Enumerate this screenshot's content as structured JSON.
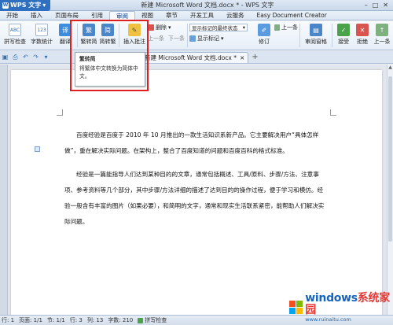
{
  "titlebar": {
    "app_label": "WPS 文字",
    "title": "新建 Microsoft Word 文档.docx * - WPS 文字"
  },
  "menu": {
    "tabs": [
      "开始",
      "插入",
      "页面布局",
      "引用",
      "审阅",
      "视图",
      "章节",
      "开发工具",
      "云服务",
      "Easy Document Creator"
    ],
    "active_index": 4
  },
  "ribbon": {
    "spell_check": "拼写检查",
    "word_count": "字数统计",
    "translate": "翻译",
    "trad_to_simp": "繁转简",
    "simp_to_trad": "简转繁",
    "insert_comment": "插入批注",
    "delete": "删除",
    "prev_1": "上一条",
    "next_1": "下一条",
    "display_select": "显示标记的最终状态",
    "show_markup": "显示标记",
    "revise": "修订",
    "prev_2": "上一条",
    "review_pane": "审阅窗格",
    "accept": "接受",
    "reject": "拒绝",
    "prev_3": "上一条"
  },
  "doctabs": {
    "tab_label": "新建 Microsoft Word 文档.docx *"
  },
  "tooltip": {
    "title": "繁转简",
    "desc": "将繁体中文转换为简体中文。"
  },
  "document": {
    "paragraphs": [
      "百度经验是百度于 2010 年 10 月推出的一款生活知识系新产品。它主要解决用户“具体怎样做”，重在解决实际问题。在架构上，整合了百度知道的问题和百度百科的格式标准。",
      "经验是一篇能指导人们达到某种目的的文章，通常包括概述、工具/原料、步骤/方法、注意事项、参考资料等几个部分，其中步骤/方法详细的描述了达到目的的操作过程，便于学习和模仿。经验一般含有丰富的图片（如果必要），和简明的文字，通常和现实生活联系紧密，能帮助人们解决实际问题。"
    ]
  },
  "statusbar": {
    "row_col": "行: 1",
    "page": "页面: 1/1",
    "section": "节: 1/1",
    "line": "行: 3",
    "column": "列: 13",
    "word_count": "字数: 210",
    "spell": "拼写检查"
  },
  "watermark": {
    "main": "windows",
    "main_accent": "系统家园",
    "sub": "www.ruinaitu.com"
  },
  "colors": {
    "accent": "#2f6fbf",
    "highlight": "#e02020"
  }
}
